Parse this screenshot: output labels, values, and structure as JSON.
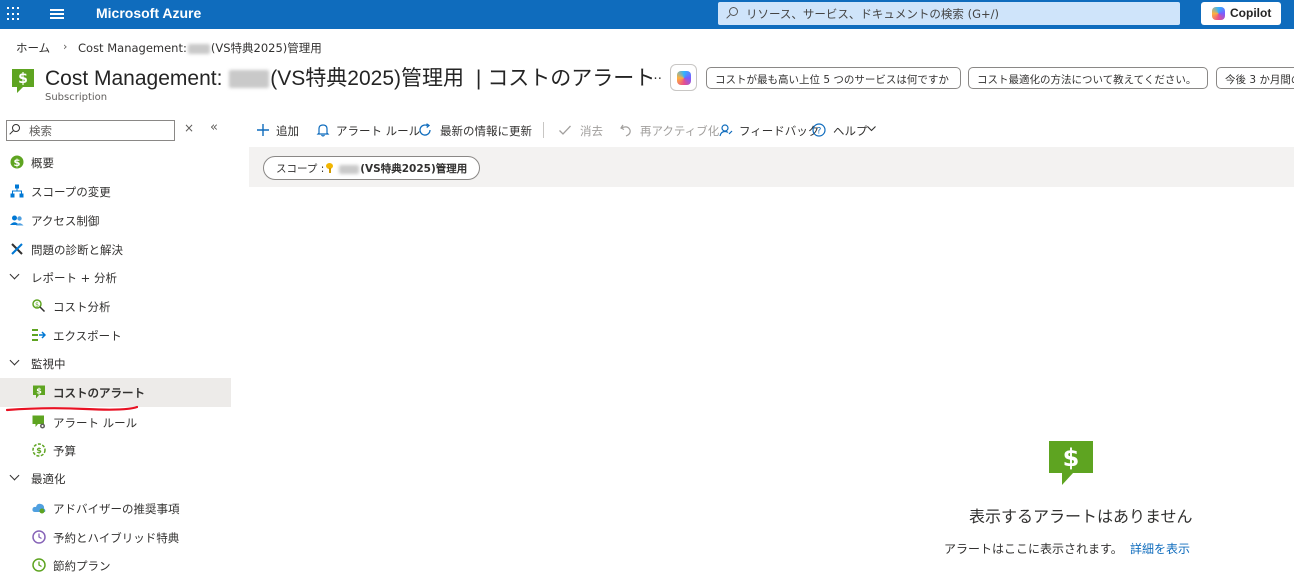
{
  "topbar": {
    "brand": "Microsoft Azure",
    "search_placeholder": "リソース、サービス、ドキュメントの検索 (G+/)",
    "copilot_label": "Copilot"
  },
  "breadcrumb": {
    "home": "ホーム",
    "current_prefix": "Cost Management:",
    "current_suffix": "(VS特典2025)管理用"
  },
  "header": {
    "title_prefix": "Cost Management:",
    "title_suffix": "(VS特典2025)管理用",
    "title_separator": "|",
    "title_page": "コストのアラート",
    "subtitle": "Subscription",
    "more": "…",
    "suggestions": [
      "コストが最も高い上位 5 つのサービスは何ですか",
      "コスト最適化の方法について教えてください。",
      "今後 3 か月間の"
    ]
  },
  "sidebar": {
    "search_placeholder": "検索",
    "clear": "×",
    "collapse": "«",
    "items": [
      {
        "label": "概要"
      },
      {
        "label": "スコープの変更"
      },
      {
        "label": "アクセス制御"
      },
      {
        "label": "問題の診断と解決"
      },
      {
        "label": "レポート + 分析"
      },
      {
        "label": "コスト分析"
      },
      {
        "label": "エクスポート"
      },
      {
        "label": "監視中"
      },
      {
        "label": "コストのアラート"
      },
      {
        "label": "アラート ルール"
      },
      {
        "label": "予算"
      },
      {
        "label": "最適化"
      },
      {
        "label": "アドバイザーの推奨事項"
      },
      {
        "label": "予約とハイブリッド特典"
      },
      {
        "label": "節約プラン"
      }
    ]
  },
  "toolbar": {
    "add": "追加",
    "alert_rules": "アラート ルール",
    "refresh": "最新の情報に更新",
    "dismiss": "消去",
    "reactivate": "再アクティブ化",
    "feedback": "フィードバック",
    "help": "ヘルプ"
  },
  "scope": {
    "label": "スコープ :",
    "value": "(VS特典2025)管理用"
  },
  "empty_state": {
    "title": "表示するアラートはありません",
    "subtitle": "アラートはここに表示されます。",
    "link": "詳細を表示"
  },
  "colors": {
    "azure_blue": "#0f6cbd",
    "cost_green": "#5ea421",
    "selected_bg": "#edebe9",
    "annotation_red": "#e81123"
  }
}
